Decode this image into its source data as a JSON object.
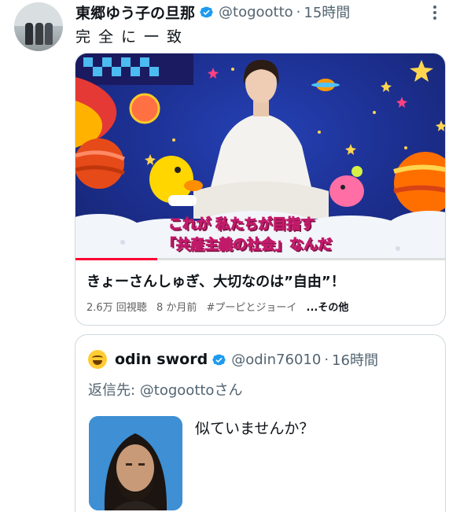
{
  "tweet": {
    "author_name": "東郷ゆう子の旦那",
    "handle": "@togootto",
    "separator": "·",
    "time": "15時間",
    "text": "完全に一致",
    "icons": {
      "verified": "verified-badge-icon",
      "more": "more-options-icon"
    }
  },
  "card": {
    "caption_line1": "これが 私たちが目指す",
    "caption_line2": "「共産主義の社会」なんだ",
    "title": "きょーさんしゅぎ、大切なのは”自由”！",
    "views": "2.6万 回視聴",
    "age": "8 か月前",
    "hashtag": "#プーピとジョーイ",
    "more": "...その他",
    "progress_fraction": 0.22
  },
  "quote": {
    "author_name": "odin sword",
    "handle": "@odin76010",
    "separator": "·",
    "time": "16時間",
    "reply_prefix": "返信先: ",
    "reply_target": "@togoottoさん",
    "text": "似ていませんか？",
    "avatar_emoji": "laughing-face-emoji"
  },
  "colors": {
    "verified": "#1d9bf0",
    "secondary_text": "#536471",
    "caption_fill": "#ffe600",
    "caption_stroke": "#c21a6a",
    "progress": "#ff0033"
  }
}
